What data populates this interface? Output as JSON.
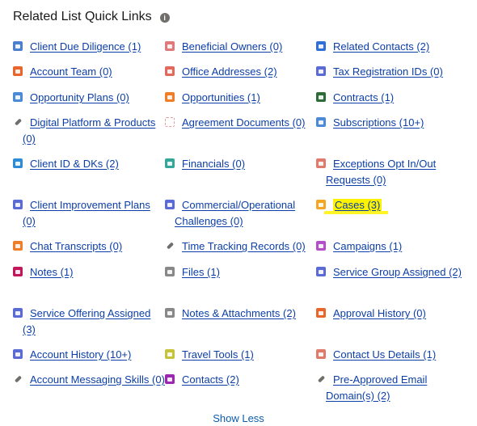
{
  "header": {
    "title": "Related List Quick Links",
    "info_icon": "info-icon"
  },
  "rows": [
    [
      {
        "label": "Client Due Diligence (1)",
        "color": "#4d7fd1",
        "icon": "list-icon"
      },
      {
        "label": "Beneficial Owners (0)",
        "color": "#e07a7a",
        "icon": "people-icon"
      },
      {
        "label": "Related Contacts (2)",
        "color": "#2e6fd8",
        "icon": "contacts-icon"
      }
    ],
    [
      {
        "label": "Account Team (0)",
        "color": "#e8652b",
        "icon": "team-icon"
      },
      {
        "label": "Office Addresses (2)",
        "color": "#e06a5e",
        "icon": "building-icon"
      },
      {
        "label": "Tax Registration IDs (0)",
        "color": "#5a6bd6",
        "icon": "custom-object-icon"
      }
    ],
    [
      {
        "label": "Opportunity Plans (0)",
        "color": "#4b8ad6",
        "icon": "plan-icon"
      },
      {
        "label": "Opportunities (1)",
        "color": "#f07d28",
        "icon": "crown-icon"
      },
      {
        "label": "Contracts (1)",
        "color": "#2d6b38",
        "icon": "contract-icon"
      }
    ],
    [
      {
        "label": "Digital Platform & Products (0)",
        "color": "#706e6b",
        "icon": "wrench-icon",
        "style": "plain"
      },
      {
        "label": "Agreement Documents (0)",
        "color": "#e8a0a0",
        "icon": "dashed-box-icon",
        "style": "dashed"
      },
      {
        "label": "Subscriptions (10+)",
        "color": "#4b8ad6",
        "icon": "subscription-icon"
      }
    ],
    [
      {
        "label": "Client ID & DKs (2)",
        "color": "#2e8bd8",
        "icon": "cube-icon"
      },
      {
        "label": "Financials (0)",
        "color": "#34a79a",
        "icon": "money-icon"
      },
      {
        "label": "Exceptions Opt In/Out Requests (0)",
        "color": "#e07a6a",
        "icon": "pencil-icon"
      }
    ],
    [
      {
        "label": "Client Improvement Plans (0)",
        "color": "#5a6bd6",
        "icon": "custom-object-icon"
      },
      {
        "label": "Commercial/Operational Challenges (0)",
        "color": "#5a6bd6",
        "icon": "custom-object-icon"
      },
      {
        "label": "Cases (3)",
        "color": "#f5a623",
        "icon": "briefcase-icon",
        "highlight": true
      }
    ],
    [
      {
        "label": "Chat Transcripts (0)",
        "color": "#f07d28",
        "icon": "chat-icon"
      },
      {
        "label": "Time Tracking Records (0)",
        "color": "#706e6b",
        "icon": "wrench-icon",
        "style": "plain"
      },
      {
        "label": "Campaigns (1)",
        "color": "#b44fc9",
        "icon": "campaign-icon"
      }
    ],
    [
      {
        "label": "Notes (1)",
        "color": "#c2185b",
        "icon": "note-icon"
      },
      {
        "label": "Files (1)",
        "color": "#8a8886",
        "icon": "file-icon"
      },
      {
        "label": "Service Group Assigned (2)",
        "color": "#5a6bd6",
        "icon": "custom-object-icon"
      }
    ],
    [
      {
        "label": "Service Offering Assigned (3)",
        "color": "#5a6bd6",
        "icon": "custom-object-icon"
      },
      {
        "label": "Notes & Attachments (2)",
        "color": "#8a8886",
        "icon": "attachment-icon"
      },
      {
        "label": "Approval History (0)",
        "color": "#e8652b",
        "icon": "approval-icon"
      }
    ],
    [
      {
        "label": "Account History (10+)",
        "color": "#5a6bd6",
        "icon": "custom-object-icon"
      },
      {
        "label": "Travel Tools (1)",
        "color": "#c5c33a",
        "icon": "travel-icon"
      },
      {
        "label": "Contact Us Details (1)",
        "color": "#e07a6a",
        "icon": "link-icon"
      }
    ],
    [
      {
        "label": "Account Messaging Skills (0)",
        "color": "#706e6b",
        "icon": "wrench-icon",
        "style": "plain"
      },
      {
        "label": "Contacts (2)",
        "color": "#9c27b0",
        "icon": "contact-card-icon"
      },
      {
        "label": "Pre-Approved Email Domain(s) (2)",
        "color": "#706e6b",
        "icon": "wrench-icon",
        "style": "plain"
      }
    ]
  ],
  "footer": {
    "show_less_label": "Show Less"
  }
}
